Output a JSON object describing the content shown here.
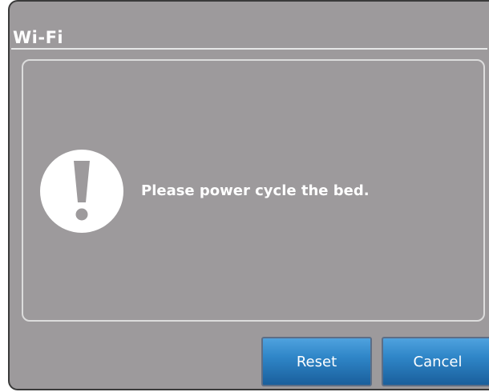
{
  "dialog": {
    "title": "Wi-Fi",
    "message": "Please power cycle the bed.",
    "icon": "exclamation-icon"
  },
  "buttons": {
    "reset_label": "Reset",
    "cancel_label": "Cancel"
  },
  "colors": {
    "dialog_background": "#9d9a9c",
    "button_blue": "#2f86c8",
    "text": "#ffffff"
  }
}
